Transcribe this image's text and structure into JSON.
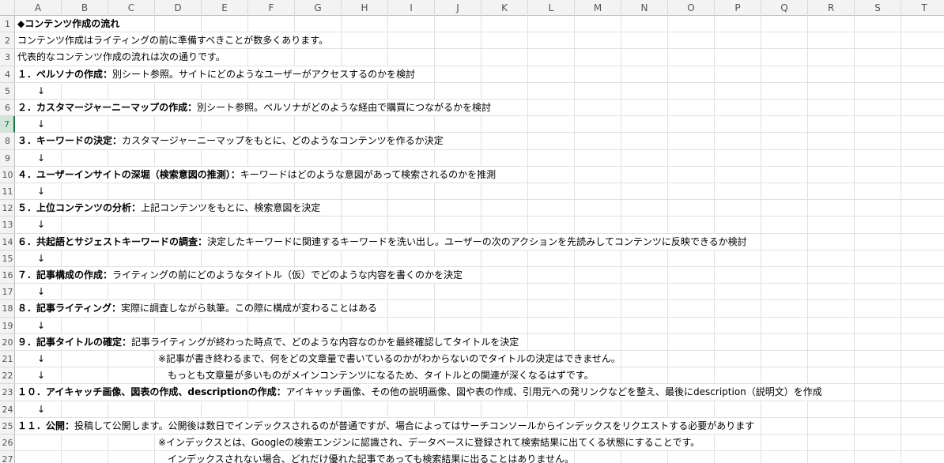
{
  "columns": [
    "A",
    "B",
    "C",
    "D",
    "E",
    "F",
    "G",
    "H",
    "I",
    "J",
    "K",
    "L",
    "M",
    "N",
    "O",
    "P",
    "Q",
    "R",
    "S",
    "T"
  ],
  "rows": [
    "1",
    "2",
    "3",
    "4",
    "5",
    "6",
    "7",
    "8",
    "9",
    "10",
    "11",
    "12",
    "13",
    "14",
    "15",
    "16",
    "17",
    "18",
    "19",
    "20",
    "21",
    "22",
    "23",
    "24",
    "25",
    "26",
    "27"
  ],
  "active_row": "7",
  "cells": [
    {
      "row": 1,
      "bold": "◆コンテンツ作成の流れ",
      "text": ""
    },
    {
      "row": 2,
      "bold": "",
      "text": "コンテンツ作成はライティングの前に準備すべきことが数多くあります。"
    },
    {
      "row": 3,
      "bold": "",
      "text": "代表的なコンテンツ作成の流れは次の通りです。"
    },
    {
      "row": 4,
      "bold": "１．ペルソナの作成：",
      "text": "別シート参照。サイトにどのようなユーザーがアクセスするのかを検討"
    },
    {
      "row": 6,
      "bold": "２．カスタマージャーニーマップの作成：",
      "text": "別シート参照。ペルソナがどのような経由で購買につながるかを検討"
    },
    {
      "row": 8,
      "bold": "３．キーワードの決定：",
      "text": "カスタマージャーニーマップをもとに、どのようなコンテンツを作るか決定"
    },
    {
      "row": 10,
      "bold": "４．ユーザーインサイトの深堀（検索意図の推測）：",
      "text": "キーワードはどのような意図があって検索されるのかを推測"
    },
    {
      "row": 12,
      "bold": "５．上位コンテンツの分析：",
      "text": "上記コンテンツをもとに、検索意図を決定"
    },
    {
      "row": 14,
      "bold": "６．共起語とサジェストキーワードの調査：",
      "text": "決定したキーワードに関連するキーワードを洗い出し。ユーザーの次のアクションを先読みしてコンテンツに反映できるか検討"
    },
    {
      "row": 16,
      "bold": "７．記事構成の作成：",
      "text": "ライティングの前にどのようなタイトル（仮）でどのような内容を書くのかを決定"
    },
    {
      "row": 18,
      "bold": "８．記事ライティング：",
      "text": "実際に調査しながら執筆。この際に構成が変わることはある"
    },
    {
      "row": 20,
      "bold": "９．記事タイトルの確定：",
      "text": "記事ライティングが終わった時点で、どのような内容なのかを最終確認してタイトルを決定"
    },
    {
      "row": 23,
      "bold": "１０．アイキャッチ画像、図表の作成、descriptionの作成：",
      "text": "アイキャッチ画像、その他の説明画像、図や表の作成、引用元への発リンクなどを整え、最後にdescription（説明文）を作成"
    },
    {
      "row": 25,
      "bold": "１１．公開：",
      "text": "投稿して公開します。公開後は数日でインデックスされるのが普通ですが、場合によってはサーチコンソールからインデックスをリクエストする必要があります"
    }
  ],
  "arrows": [
    5,
    7,
    9,
    11,
    13,
    15,
    17,
    19,
    21,
    22,
    24
  ],
  "arrow_glyph": "↓",
  "notes": [
    {
      "row": 21,
      "text": "※記事が書き終わるまで、何をどの文章量で書いているのかがわからないのでタイトルの決定はできません。"
    },
    {
      "row": 22,
      "text": "　もっとも文章量が多いものがメインコンテンツになるため、タイトルとの関連が深くなるはずです。"
    },
    {
      "row": 26,
      "text": "※インデックスとは、Googleの検索エンジンに認識され、データベースに登録されて検索結果に出てくる状態にすることです。"
    },
    {
      "row": 27,
      "text": "　インデックスされない場合、どれだけ優れた記事であっても検索結果に出ることはありません。"
    }
  ]
}
